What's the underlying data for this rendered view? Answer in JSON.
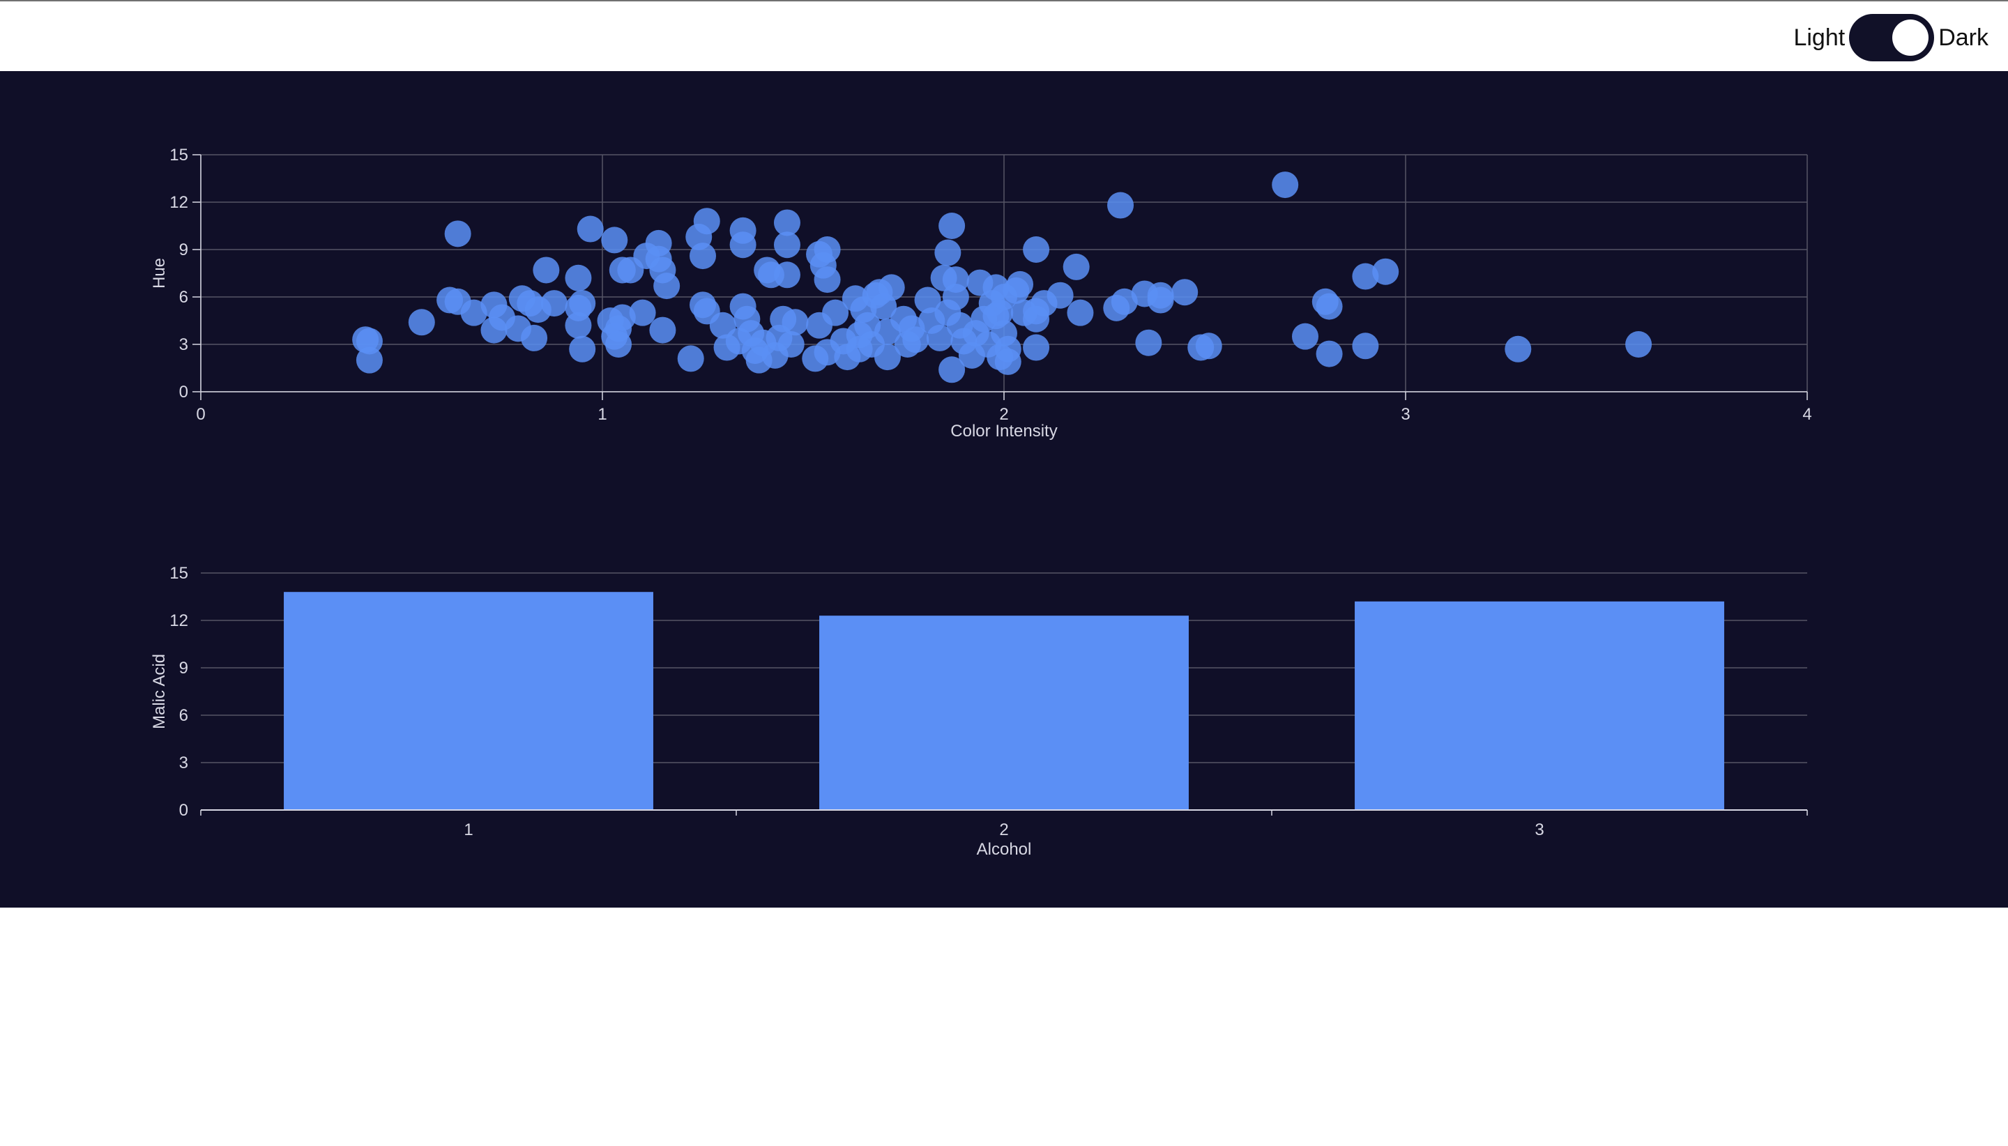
{
  "theme_toggle": {
    "light_label": "Light",
    "dark_label": "Dark",
    "selected": "Dark"
  },
  "colors": {
    "panel_background": "#100f28",
    "marker": "#5b8ff5",
    "grid": "#555566",
    "axis_text": "#d8d8e4"
  },
  "chart_data": [
    {
      "type": "scatter",
      "title": "",
      "xlabel": "Color Intensity",
      "ylabel": "Hue",
      "xlim": [
        0,
        4
      ],
      "ylim": [
        0,
        15
      ],
      "x_ticks": [
        "0",
        "1",
        "2",
        "3",
        "4"
      ],
      "y_ticks": [
        "0",
        "3",
        "6",
        "9",
        "12",
        "15"
      ],
      "grid": true,
      "points": [
        [
          0.41,
          3.3
        ],
        [
          0.42,
          2.0
        ],
        [
          0.42,
          3.2
        ],
        [
          0.55,
          4.4
        ],
        [
          0.62,
          5.8
        ],
        [
          0.64,
          10.0
        ],
        [
          0.64,
          5.7
        ],
        [
          0.68,
          5.0
        ],
        [
          0.73,
          5.5
        ],
        [
          0.73,
          3.9
        ],
        [
          0.75,
          4.7
        ],
        [
          0.79,
          4.0
        ],
        [
          0.8,
          5.9
        ],
        [
          0.82,
          5.6
        ],
        [
          0.83,
          3.4
        ],
        [
          0.84,
          5.2
        ],
        [
          0.86,
          7.7
        ],
        [
          0.88,
          5.6
        ],
        [
          0.94,
          7.2
        ],
        [
          0.94,
          5.3
        ],
        [
          0.94,
          4.2
        ],
        [
          0.95,
          2.7
        ],
        [
          0.95,
          5.6
        ],
        [
          0.97,
          10.3
        ],
        [
          1.02,
          4.5
        ],
        [
          1.03,
          9.6
        ],
        [
          1.03,
          3.5
        ],
        [
          1.04,
          4.0
        ],
        [
          1.04,
          3.0
        ],
        [
          1.05,
          7.7
        ],
        [
          1.05,
          4.7
        ],
        [
          1.07,
          7.7
        ],
        [
          1.1,
          5.0
        ],
        [
          1.11,
          8.6
        ],
        [
          1.14,
          8.4
        ],
        [
          1.14,
          9.4
        ],
        [
          1.15,
          7.7
        ],
        [
          1.15,
          3.9
        ],
        [
          1.16,
          6.7
        ],
        [
          1.22,
          2.1
        ],
        [
          1.24,
          9.8
        ],
        [
          1.25,
          8.6
        ],
        [
          1.25,
          5.5
        ],
        [
          1.26,
          5.1
        ],
        [
          1.26,
          10.8
        ],
        [
          1.3,
          4.2
        ],
        [
          1.31,
          2.8
        ],
        [
          1.34,
          3.2
        ],
        [
          1.35,
          10.2
        ],
        [
          1.35,
          9.3
        ],
        [
          1.35,
          5.4
        ],
        [
          1.36,
          4.6
        ],
        [
          1.37,
          3.7
        ],
        [
          1.38,
          2.6
        ],
        [
          1.39,
          2.0
        ],
        [
          1.4,
          3.1
        ],
        [
          1.41,
          7.7
        ],
        [
          1.42,
          7.4
        ],
        [
          1.43,
          2.3
        ],
        [
          1.44,
          3.4
        ],
        [
          1.45,
          4.6
        ],
        [
          1.46,
          10.7
        ],
        [
          1.46,
          9.3
        ],
        [
          1.46,
          7.4
        ],
        [
          1.47,
          3.0
        ],
        [
          1.48,
          4.4
        ],
        [
          1.53,
          2.1
        ],
        [
          1.54,
          8.7
        ],
        [
          1.54,
          4.2
        ],
        [
          1.55,
          8.0
        ],
        [
          1.56,
          7.1
        ],
        [
          1.56,
          9.0
        ],
        [
          1.56,
          2.5
        ],
        [
          1.58,
          5.0
        ],
        [
          1.6,
          3.2
        ],
        [
          1.61,
          2.2
        ],
        [
          1.63,
          5.9
        ],
        [
          1.64,
          3.6
        ],
        [
          1.64,
          2.7
        ],
        [
          1.65,
          5.2
        ],
        [
          1.66,
          4.2
        ],
        [
          1.67,
          3.0
        ],
        [
          1.68,
          6.1
        ],
        [
          1.69,
          6.3
        ],
        [
          1.7,
          5.4
        ],
        [
          1.71,
          3.8
        ],
        [
          1.71,
          2.2
        ],
        [
          1.72,
          6.6
        ],
        [
          1.75,
          4.6
        ],
        [
          1.76,
          3.0
        ],
        [
          1.77,
          4.0
        ],
        [
          1.78,
          3.3
        ],
        [
          1.81,
          5.8
        ],
        [
          1.82,
          4.5
        ],
        [
          1.84,
          3.4
        ],
        [
          1.85,
          7.2
        ],
        [
          1.86,
          8.8
        ],
        [
          1.86,
          5.0
        ],
        [
          1.87,
          1.4
        ],
        [
          1.87,
          10.5
        ],
        [
          1.88,
          7.1
        ],
        [
          1.88,
          6.0
        ],
        [
          1.89,
          4.2
        ],
        [
          1.9,
          3.2
        ],
        [
          1.92,
          2.3
        ],
        [
          1.93,
          3.7
        ],
        [
          1.94,
          6.9
        ],
        [
          1.95,
          4.6
        ],
        [
          1.96,
          3.0
        ],
        [
          1.97,
          5.6
        ],
        [
          1.98,
          4.8
        ],
        [
          1.98,
          6.6
        ],
        [
          1.99,
          5.0
        ],
        [
          1.99,
          2.2
        ],
        [
          2.0,
          3.7
        ],
        [
          2.0,
          6.0
        ],
        [
          2.01,
          1.9
        ],
        [
          2.01,
          2.7
        ],
        [
          2.03,
          6.4
        ],
        [
          2.04,
          6.8
        ],
        [
          2.05,
          5.0
        ],
        [
          2.08,
          9.0
        ],
        [
          2.08,
          5.1
        ],
        [
          2.08,
          4.6
        ],
        [
          2.08,
          2.8
        ],
        [
          2.1,
          5.6
        ],
        [
          2.14,
          6.1
        ],
        [
          2.18,
          7.9
        ],
        [
          2.19,
          5.0
        ],
        [
          2.28,
          5.3
        ],
        [
          2.29,
          11.8
        ],
        [
          2.3,
          5.7
        ],
        [
          2.35,
          6.2
        ],
        [
          2.36,
          3.1
        ],
        [
          2.39,
          6.1
        ],
        [
          2.39,
          5.8
        ],
        [
          2.45,
          6.3
        ],
        [
          2.49,
          2.8
        ],
        [
          2.51,
          2.9
        ],
        [
          2.7,
          13.1
        ],
        [
          2.75,
          3.5
        ],
        [
          2.8,
          5.7
        ],
        [
          2.81,
          5.4
        ],
        [
          2.81,
          2.4
        ],
        [
          2.9,
          7.3
        ],
        [
          2.9,
          2.9
        ],
        [
          2.95,
          7.6
        ],
        [
          3.28,
          2.7
        ],
        [
          3.58,
          3.0
        ]
      ]
    },
    {
      "type": "bar",
      "title": "",
      "xlabel": "Alcohol",
      "ylabel": "Malic Acid",
      "categories": [
        "1",
        "2",
        "3"
      ],
      "values": [
        13.8,
        12.3,
        13.2
      ],
      "ylim": [
        0,
        15
      ],
      "y_ticks": [
        "0",
        "3",
        "6",
        "9",
        "12",
        "15"
      ],
      "grid": true
    }
  ]
}
